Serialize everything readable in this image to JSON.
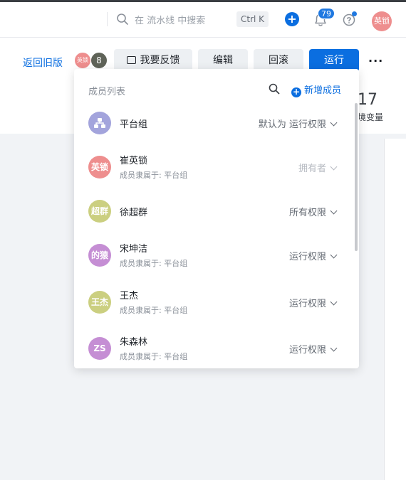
{
  "header": {
    "search_placeholder": "在 流水线 中搜索",
    "shortcut": "Ctrl K",
    "notification_count": "79",
    "user_avatar": "英锁"
  },
  "toolbar": {
    "back_label": "返回旧版",
    "avatar_1": "英锁",
    "avatar_2": "8",
    "feedback_label": "我要反馈",
    "edit_label": "编辑",
    "rollback_label": "回滚",
    "run_label": "运行",
    "more_label": "···"
  },
  "background": {
    "stat_value": "17",
    "stat_label": "境变量"
  },
  "popover": {
    "title": "成员列表",
    "add_label": "新增成员",
    "members": [
      {
        "name": "平台组",
        "sub": "",
        "permission": "默认为 运行权限",
        "avatar": "group",
        "color": "#a3a4dc",
        "disabled": false
      },
      {
        "name": "崔英锁",
        "sub": "成员隶属于: 平台组",
        "permission": "拥有者",
        "avatar": "英锁",
        "color": "#ee8e8e",
        "disabled": true
      },
      {
        "name": "徐超群",
        "sub": "",
        "permission": "所有权限",
        "avatar": "超群",
        "color": "#cbcf80",
        "disabled": false
      },
      {
        "name": "宋坤洁",
        "sub": "成员隶属于: 平台组",
        "permission": "运行权限",
        "avatar": "的猿",
        "color": "#c58ed4",
        "disabled": false
      },
      {
        "name": "王杰",
        "sub": "成员隶属于: 平台组",
        "permission": "运行权限",
        "avatar": "王杰",
        "color": "#cbcf80",
        "disabled": false
      },
      {
        "name": "朱森林",
        "sub": "成员隶属于: 平台组",
        "permission": "运行权限",
        "avatar": "ZS",
        "color": "#c58ed4",
        "disabled": false
      }
    ]
  },
  "colors": {
    "primary": "#0b6ee0",
    "background": "#f1f3f6"
  }
}
